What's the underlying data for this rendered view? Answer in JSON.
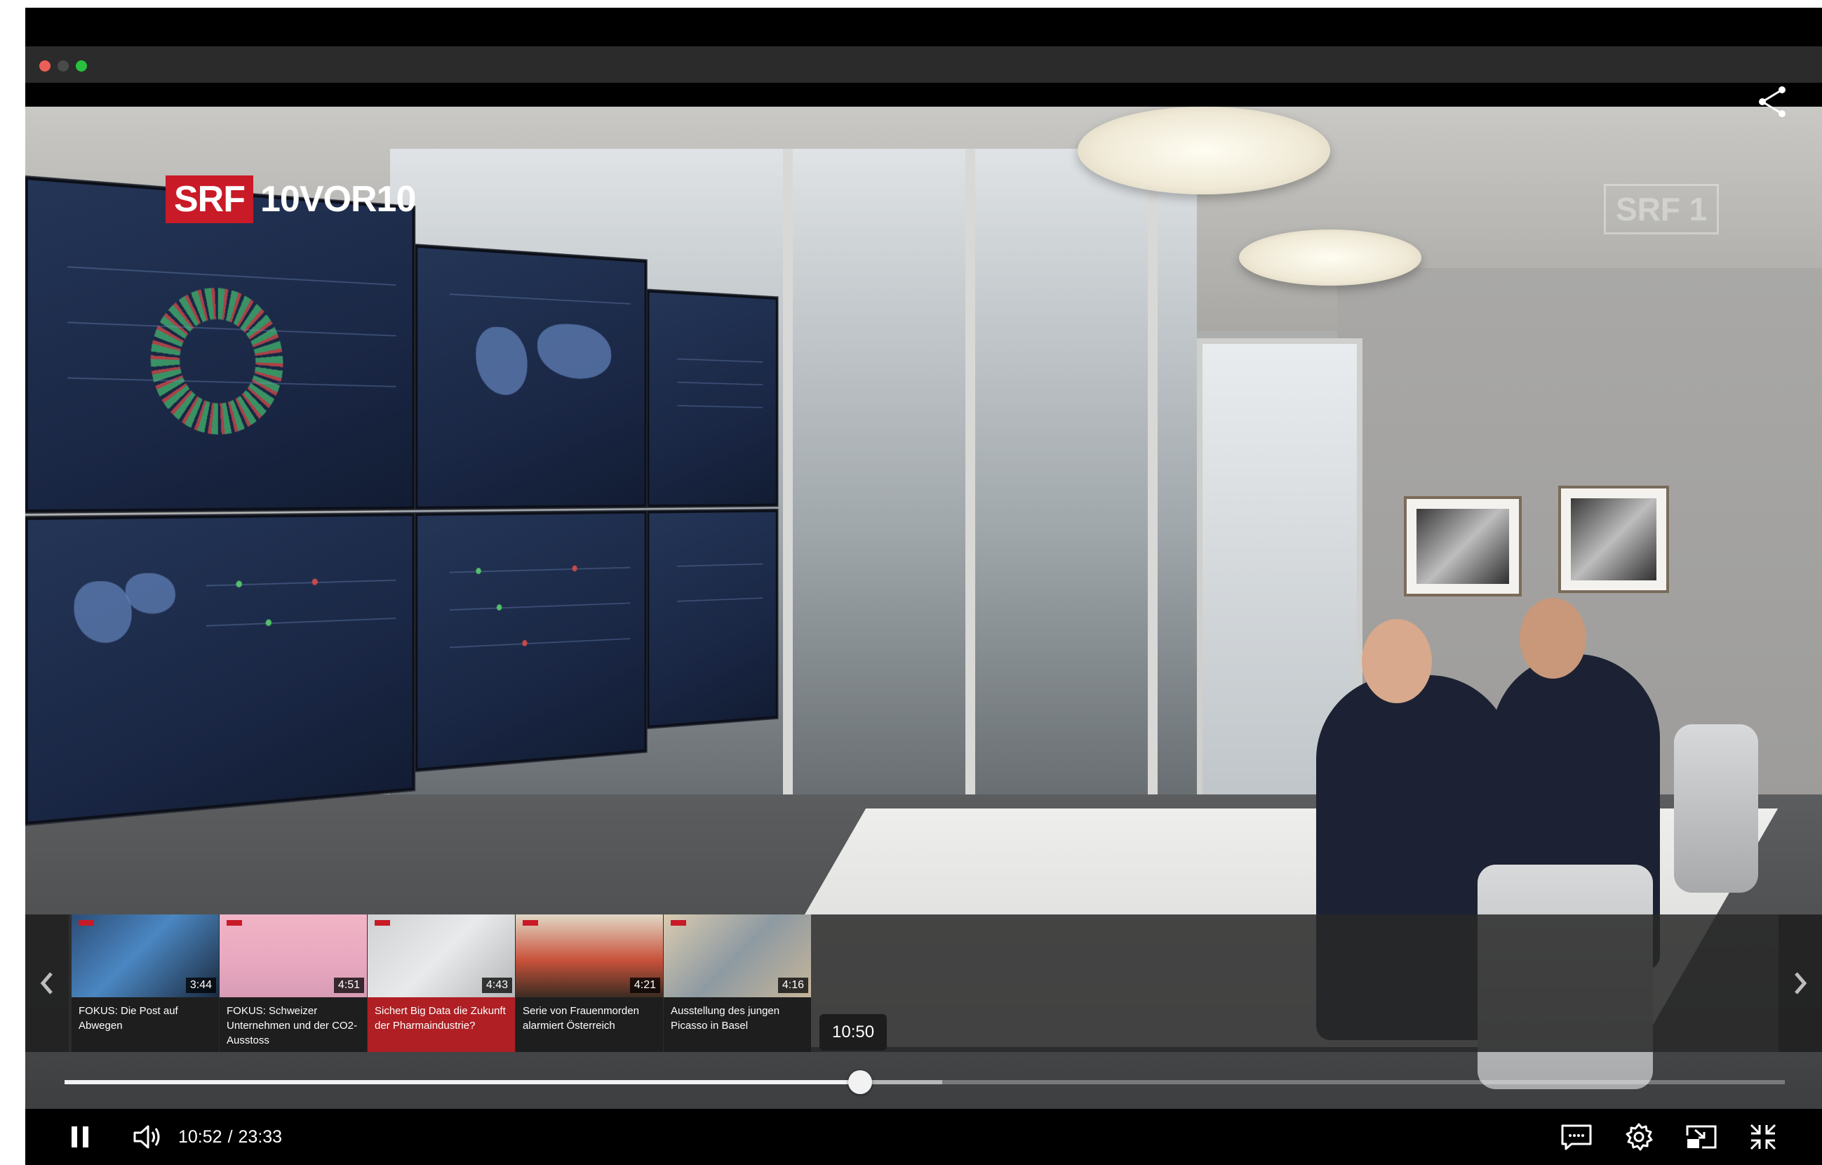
{
  "player": {
    "current_time": "10:52",
    "duration": "23:33",
    "hover_time": "10:50",
    "progress_fraction": 0.4625,
    "buffered_fraction": 0.51
  },
  "overlay": {
    "channel_logo": "SRF",
    "show_logo": "10VOR10",
    "watermark": "SRF 1"
  },
  "playlist": {
    "items": [
      {
        "title": "FOKUS: Die Post auf Abwegen",
        "duration": "3:44",
        "active": false
      },
      {
        "title": "FOKUS: Schweizer Unternehmen und der CO2-Ausstoss",
        "duration": "4:51",
        "active": false
      },
      {
        "title": "Sichert Big Data die Zukunft der Pharmaindustrie?",
        "duration": "4:43",
        "active": true
      },
      {
        "title": "Serie von Frauenmorden alarmiert Österreich",
        "duration": "4:21",
        "active": false
      },
      {
        "title": "Ausstellung des jungen Picasso in Basel",
        "duration": "4:16",
        "active": false
      }
    ]
  },
  "icons": {
    "share": "share-icon",
    "pause": "pause-icon",
    "volume": "volume-icon",
    "subtitles": "subtitles-icon",
    "settings": "gear-icon",
    "pip": "picture-in-picture-icon",
    "exit_fullscreen": "exit-fullscreen-icon",
    "rail_prev": "chevron-left-icon",
    "rail_next": "chevron-right-icon"
  },
  "colors": {
    "accent": "#af1f23",
    "srf_red": "#c91a27"
  }
}
